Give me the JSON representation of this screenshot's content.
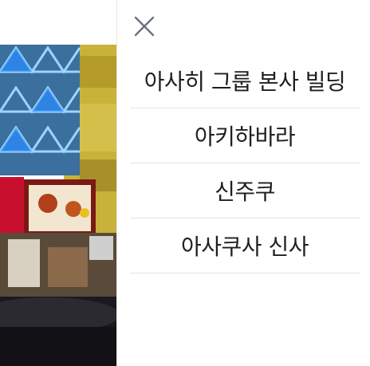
{
  "drawer": {
    "close_icon": "close-icon",
    "items": [
      {
        "label": "아사히 그룹 본사 빌딩"
      },
      {
        "label": "아키하바라"
      },
      {
        "label": "신주쿠"
      },
      {
        "label": "아사쿠사 신사"
      }
    ]
  },
  "colors": {
    "text": "#1f1f1f",
    "divider": "#e3e3e3",
    "close_icon": "#6b7280",
    "panel_bg": "#ffffff"
  }
}
